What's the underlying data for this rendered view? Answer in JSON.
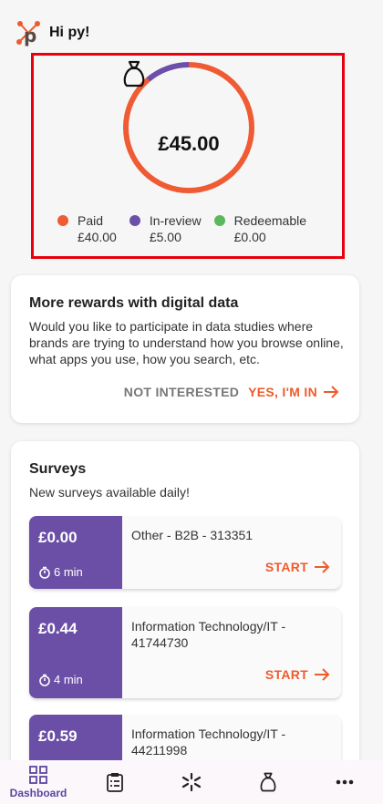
{
  "header": {
    "greeting": "Hi py!",
    "logo_icon": "p-logo-icon"
  },
  "balance": {
    "total": "£45.00",
    "icon": "money-bag-icon",
    "paid_value": 40.0,
    "in_review_value": 5.0,
    "redeemable_value": 0.0,
    "legend": [
      {
        "label": "Paid",
        "amount": "£40.00",
        "color": "#ef5b32"
      },
      {
        "label": "In-review",
        "amount": "£5.00",
        "color": "#6c4fa8"
      },
      {
        "label": "Redeemable",
        "amount": "£0.00",
        "color": "#5cb85c"
      }
    ]
  },
  "digital": {
    "title": "More rewards with digital data",
    "body": "Would you like to participate in data studies where brands are trying to understand how you browse online, what apps you use, how you search, etc.",
    "decline_label": "NOT INTERESTED",
    "accept_label": "YES, I'M IN"
  },
  "surveys": {
    "title": "Surveys",
    "subtitle": "New surveys available daily!",
    "start_label": "START",
    "items": [
      {
        "price": "£0.00",
        "time": "6 min",
        "name": "Other - B2B - 313351"
      },
      {
        "price": "£0.44",
        "time": "4 min",
        "name": "Information Technology/IT - 41744730"
      },
      {
        "price": "£0.59",
        "time": "",
        "name": "Information Technology/IT - 44211998"
      }
    ]
  },
  "nav": {
    "items": [
      {
        "label": "Dashboard",
        "icon": "dashboard-icon"
      },
      {
        "label": "",
        "icon": "clipboard-list-icon"
      },
      {
        "label": "",
        "icon": "asterisk-network-icon"
      },
      {
        "label": "",
        "icon": "money-bag-icon"
      },
      {
        "label": "",
        "icon": "more-dots-icon"
      }
    ]
  },
  "colors": {
    "accent": "#ee5b2c",
    "purple": "#6b4fa6",
    "highlight_border": "#e8000c"
  }
}
